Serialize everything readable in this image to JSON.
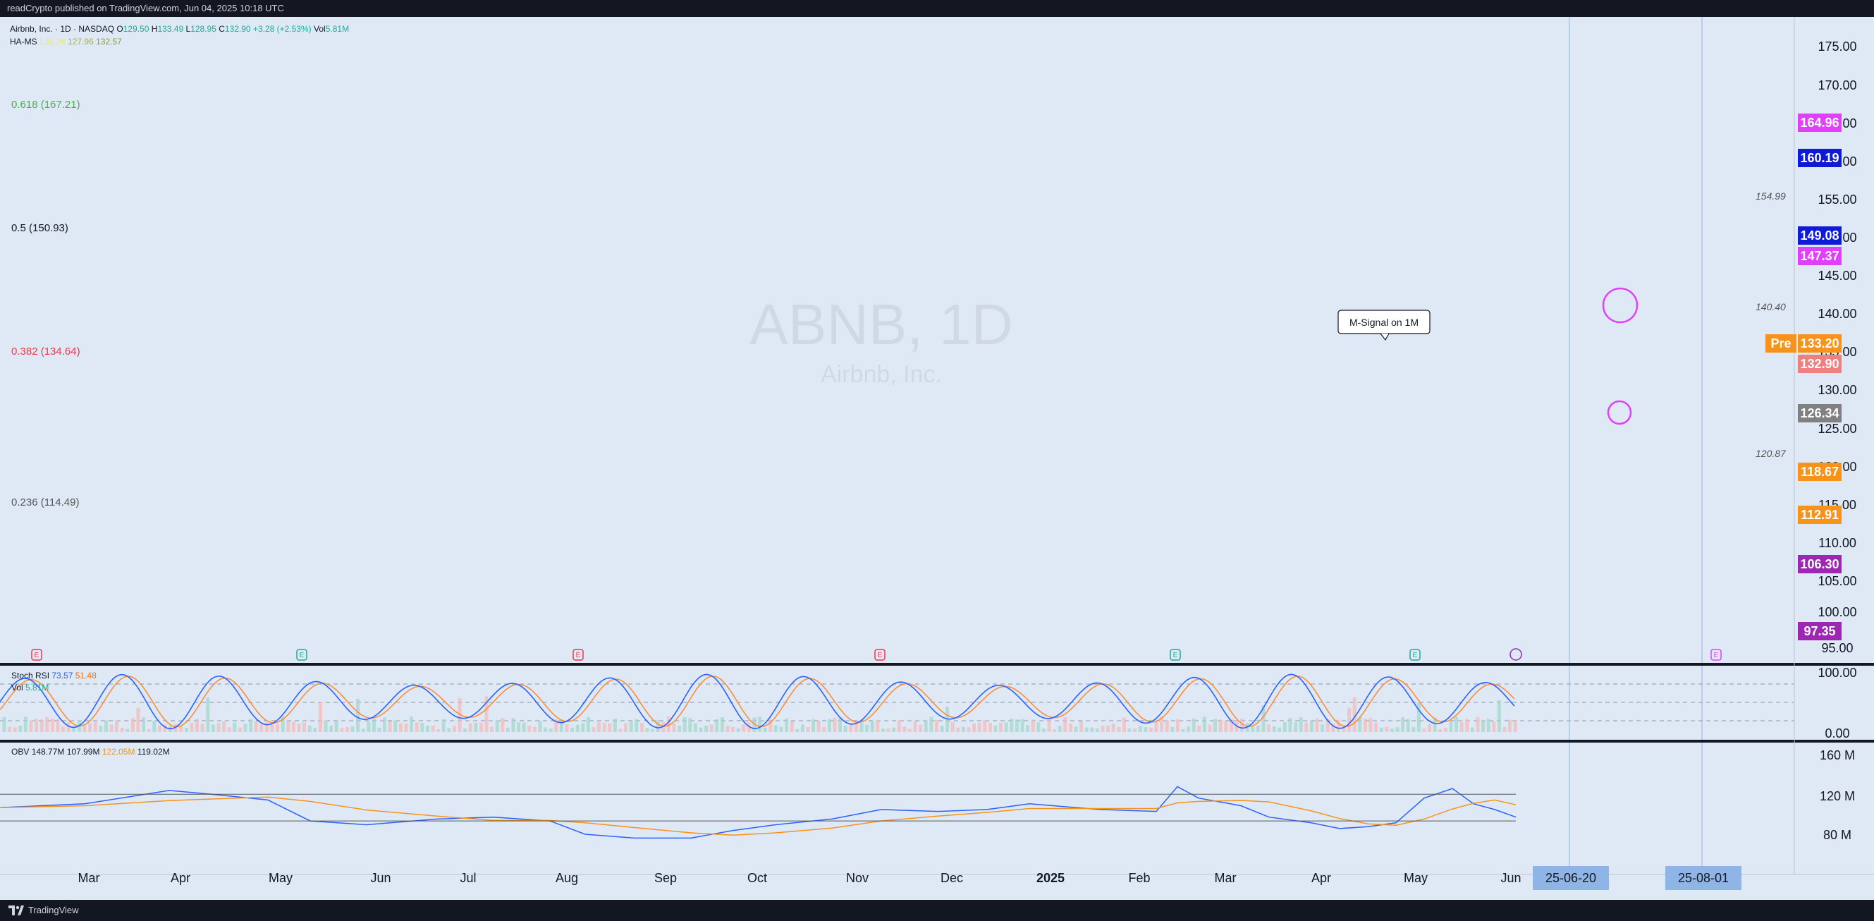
{
  "header": {
    "published": "readCrypto published on TradingView.com, Jun 04, 2025 10:18 UTC"
  },
  "legend": {
    "symbol": "Airbnb, Inc. · 1D · NASDAQ",
    "o_label": "O",
    "o_value": "129.50",
    "h_label": "H",
    "h_value": "133.49",
    "l_label": "L",
    "l_value": "128.95",
    "c_label": "C",
    "c_value": "132.90",
    "change": "+3.28 (+2.53%)",
    "vol_label": "Vol",
    "vol_value": "5.81M",
    "indicator_name": "HA-MS",
    "indicator_v1": "131.24",
    "indicator_v2": "127.96",
    "indicator_v3": "132.57"
  },
  "watermark": {
    "symbol": "ABNB, 1D",
    "name": "Airbnb, Inc."
  },
  "fib_labels": [
    {
      "text": "0.618 (167.21)",
      "color": "#4caf50"
    },
    {
      "text": "0.5 (150.93)",
      "color": "#131722"
    },
    {
      "text": "0.382 (134.64)",
      "color": "#f23645"
    },
    {
      "text": "0.236 (114.49)",
      "color": "#555555"
    }
  ],
  "line_labels": [
    "154.99",
    "140.40",
    "120.87"
  ],
  "callout": "M-Signal on 1M",
  "price_axis": {
    "ticks": [
      "175.00",
      "170.00",
      "165.00",
      "160.00",
      "155.00",
      "150.00",
      "145.00",
      "140.00",
      "135.00",
      "130.00",
      "125.00",
      "120.00",
      "115.00",
      "110.00",
      "105.00",
      "100.00",
      "95.00"
    ],
    "badges": [
      {
        "text": "164.96",
        "color": "#e040fb"
      },
      {
        "text": "160.19",
        "color": "#0d1bd6"
      },
      {
        "text": "149.08",
        "color": "#0d1bd6"
      },
      {
        "text": "147.37",
        "color": "#e040fb"
      },
      {
        "text": "133.20",
        "color": "#f7931a"
      },
      {
        "text": "132.90",
        "color": "#f08080"
      },
      {
        "text": "126.34",
        "color": "#808080"
      },
      {
        "text": "118.67",
        "color": "#f7931a"
      },
      {
        "text": "112.91",
        "color": "#f7931a"
      },
      {
        "text": "106.30",
        "color": "#9c27b0"
      },
      {
        "text": "97.35",
        "color": "#9c27b0"
      }
    ],
    "pre_label": "Pre"
  },
  "stoch": {
    "name": "Stoch RSI",
    "k": "73.57",
    "d": "51.48",
    "vol_label": "Vol",
    "vol_value": "5.81M",
    "axis": [
      "100.00",
      "0.00"
    ]
  },
  "obv": {
    "name": "OBV",
    "v1": "148.77M",
    "v2": "107.99M",
    "v3": "122.05M",
    "v4": "119.02M",
    "axis": [
      "160 M",
      "120 M",
      "80 M"
    ]
  },
  "time_axis": {
    "labels": [
      "Mar",
      "Apr",
      "May",
      "Jun",
      "Jul",
      "Aug",
      "Sep",
      "Oct",
      "Nov",
      "Dec",
      "2025",
      "Feb",
      "Mar",
      "Apr",
      "May",
      "Jun"
    ],
    "badges": [
      "25-06-20",
      "25-08-01"
    ]
  },
  "events": [
    "E",
    "E",
    "E",
    "E",
    "E",
    "E",
    "E"
  ],
  "footer": {
    "brand": "TradingView"
  },
  "colors": {
    "chart_bg": "#dfe9f6",
    "trendline": "#7b1c5a",
    "fib_zone": "#c7d2e0"
  }
}
